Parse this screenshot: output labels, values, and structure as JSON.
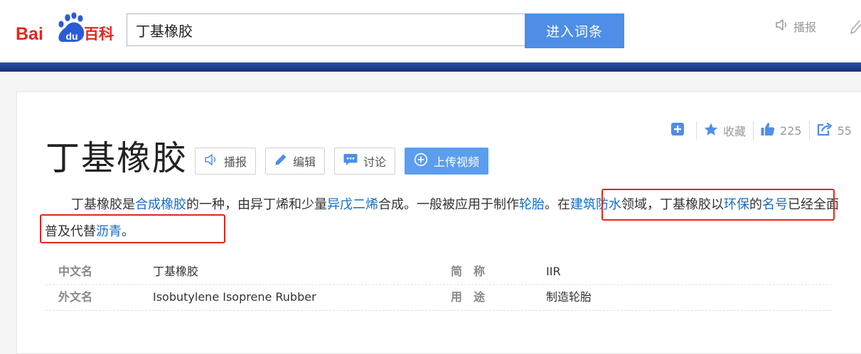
{
  "header": {
    "logo_text": "Baidu百科",
    "search_value": "丁基橡胶",
    "enter_button": "进入词条",
    "broadcast_label": "播报"
  },
  "toolbar": {
    "collect_label": "收藏",
    "like_count": "225",
    "share_count": "55"
  },
  "entry": {
    "title": "丁基橡胶",
    "buttons": {
      "broadcast": "播报",
      "edit": "编辑",
      "discuss": "讨论",
      "upload_video": "上传视频"
    }
  },
  "summary": {
    "segments": [
      {
        "text": "丁基橡胶是",
        "link": false
      },
      {
        "text": "合成橡胶",
        "link": true
      },
      {
        "text": "的一种，由异丁烯和少量",
        "link": false
      },
      {
        "text": "异戊二烯",
        "link": true
      },
      {
        "text": "合成。一般被应用于制作",
        "link": false
      },
      {
        "text": "轮胎",
        "link": true
      },
      {
        "text": "。在",
        "link": false
      },
      {
        "text": "建筑防水",
        "link": true
      },
      {
        "text": "领域，丁基橡胶以",
        "link": false
      },
      {
        "text": "环保",
        "link": true
      },
      {
        "text": "的",
        "link": false
      },
      {
        "text": "名号",
        "link": true
      },
      {
        "text": "已经全面普及代替",
        "link": false
      },
      {
        "text": "沥青",
        "link": true
      },
      {
        "text": "。",
        "link": false
      }
    ]
  },
  "basic_info": [
    {
      "left_key": "中文名",
      "left_value": "丁基橡胶",
      "right_key": "简　称",
      "right_value": "IIR"
    },
    {
      "left_key": "外文名",
      "left_value": "Isobutylene Isoprene Rubber",
      "right_key": "用　途",
      "right_value": "制造轮胎"
    }
  ],
  "colors": {
    "accent": "#4e8ee6",
    "link": "#136ec2",
    "highlight_box": "#e3261e",
    "nav_bar": "#213e8a"
  }
}
